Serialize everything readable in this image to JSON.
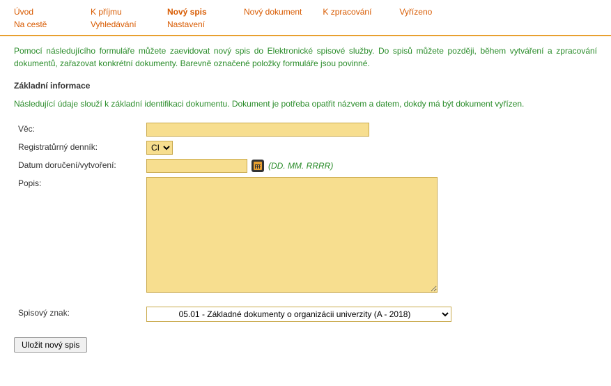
{
  "nav": {
    "row1": [
      {
        "label": "Úvod",
        "active": false
      },
      {
        "label": "K příjmu",
        "active": false
      },
      {
        "label": "Nový spis",
        "active": true
      },
      {
        "label": "Nový dokument",
        "active": false
      },
      {
        "label": "K zpracování",
        "active": false
      },
      {
        "label": "Vyřízeno",
        "active": false
      }
    ],
    "row2": [
      {
        "label": "Na cestě",
        "active": false
      },
      {
        "label": "Vyhledávání",
        "active": false
      },
      {
        "label": "Nastavení",
        "active": false
      }
    ]
  },
  "intro": "Pomocí následujícího formuláře můžete zaevidovat nový spis do Elektronické spisové služby. Do spisů můžete později, během vytváření a zpracování dokumentů, zařazovat konkrétní dokumenty. Barevně označené položky formuláře jsou povinné.",
  "section": {
    "title": "Základní informace",
    "desc": "Následující údaje slouží k základní identifikaci dokumentu. Dokument je potřeba opatřit názvem a datem, dokdy má být dokument vyřízen."
  },
  "form": {
    "vec": {
      "label": "Věc:",
      "value": ""
    },
    "dennik": {
      "label": "Registratůrný denník:",
      "selected": "CI"
    },
    "datum": {
      "label": "Datum doručení/vytvoření:",
      "value": "",
      "hint": "(DD. MM. RRRR)"
    },
    "popis": {
      "label": "Popis:",
      "value": ""
    },
    "spisovy": {
      "label": "Spisový znak:",
      "selected": "05.01 - Základné dokumenty o organizácii univerzity (A - 2018)"
    }
  },
  "submit": {
    "label": "Uložit nový spis"
  }
}
